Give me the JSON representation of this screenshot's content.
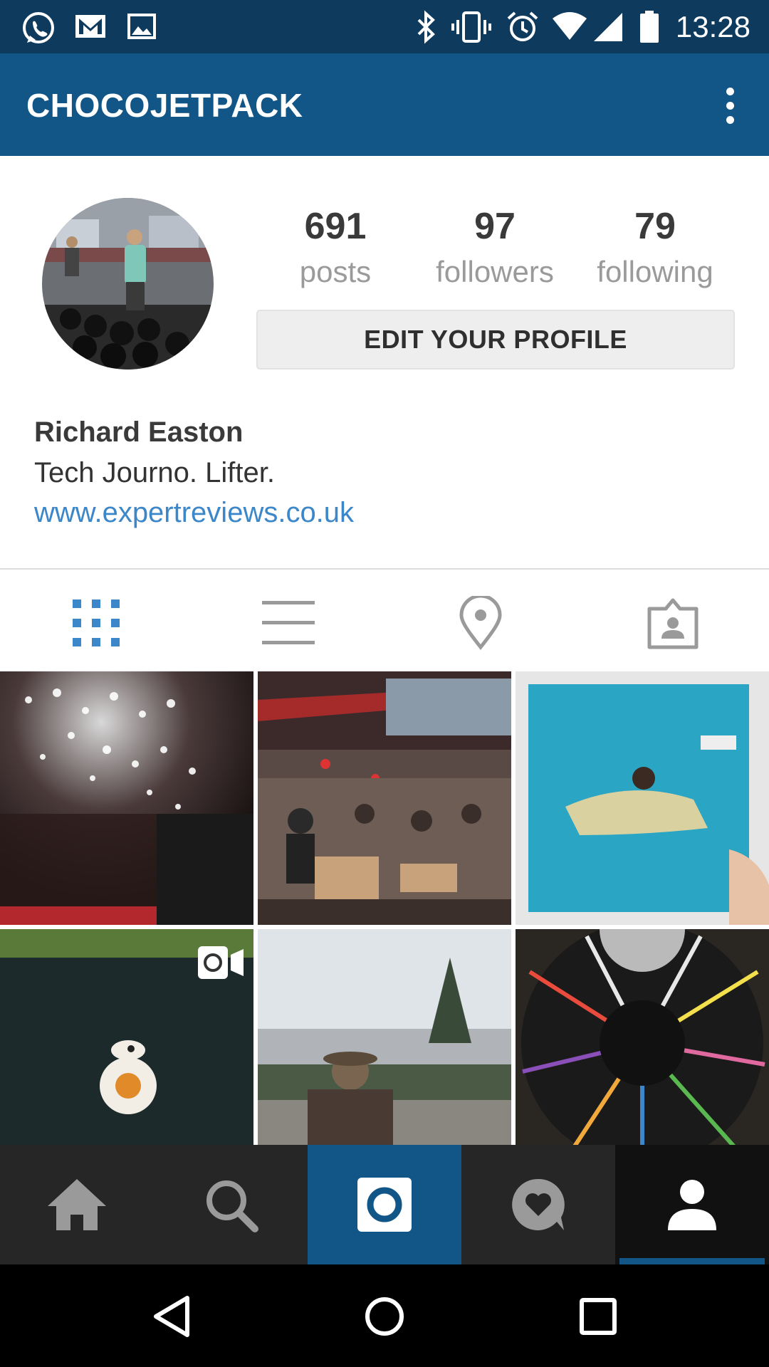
{
  "status_bar": {
    "time": "13:28",
    "left_icons": [
      "whatsapp-icon",
      "gmail-icon",
      "image-icon"
    ],
    "right_icons": [
      "bluetooth-icon",
      "vibrate-icon",
      "alarm-icon",
      "wifi-icon",
      "signal-icon",
      "battery-icon"
    ]
  },
  "app_bar": {
    "title": "CHOCOJETPACK",
    "menu_icon": "overflow-menu-icon"
  },
  "profile": {
    "stats": [
      {
        "value": "691",
        "label": "posts"
      },
      {
        "value": "97",
        "label": "followers"
      },
      {
        "value": "79",
        "label": "following"
      }
    ],
    "edit_button": "EDIT YOUR PROFILE",
    "name": "Richard Easton",
    "bio": "Tech Journo. Lifter.",
    "website": "www.expertreviews.co.uk"
  },
  "view_tabs": [
    {
      "icon": "grid-view-icon",
      "active": true
    },
    {
      "icon": "list-view-icon",
      "active": false
    },
    {
      "icon": "location-pin-icon",
      "active": false
    },
    {
      "icon": "tagged-photos-icon",
      "active": false
    }
  ],
  "grid": {
    "tiles": [
      {
        "subject": "chandelier-lights"
      },
      {
        "subject": "crowded-cafe"
      },
      {
        "subject": "vinyl-record-swimmer"
      },
      {
        "subject": "bb8-toy",
        "video": true
      },
      {
        "subject": "man-with-camera-river"
      },
      {
        "subject": "rainbow-vinyl"
      }
    ]
  },
  "bottom_nav": [
    {
      "icon": "home-icon"
    },
    {
      "icon": "search-icon"
    },
    {
      "icon": "camera-icon",
      "highlighted": true
    },
    {
      "icon": "activity-heart-icon"
    },
    {
      "icon": "profile-icon",
      "active": true
    }
  ],
  "system_nav": [
    "back-icon",
    "home-circle-icon",
    "recents-icon"
  ],
  "colors": {
    "status_bar": "#0e3a5e",
    "app_bar": "#125688",
    "link": "#3b87c9",
    "active_tab": "#3b87c9"
  }
}
